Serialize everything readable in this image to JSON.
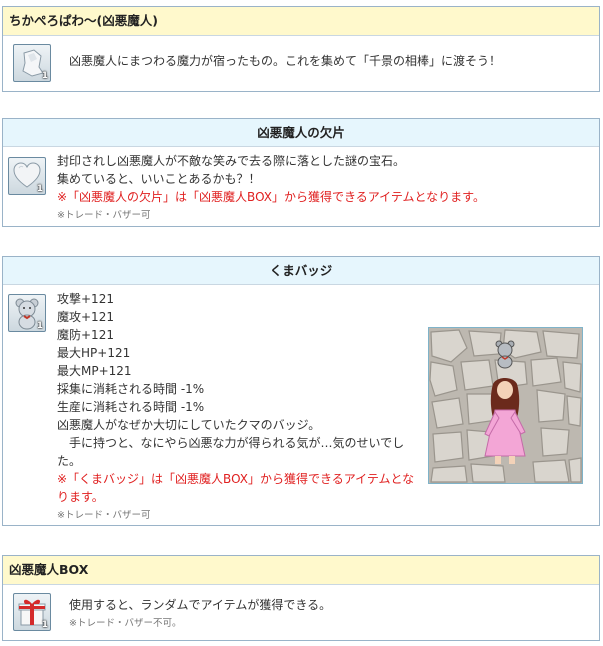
{
  "sections": [
    {
      "title": "ちかぺろぱわ～(凶悪魔人)",
      "icon": "white-fragment-icon",
      "quantity": "1",
      "lines": [
        "凶悪魔人にまつわる魔力が宿ったもの。これを集めて「千景の相棒」に渡そう！"
      ]
    },
    {
      "title": "凶悪魔人の欠片",
      "icon": "heart-stone-icon",
      "quantity": "1",
      "lines": [
        "封印されし凶悪魔人が不敵な笑みで去る際に落とした謎の宝石。",
        "集めていると、いいことあるかも？！"
      ],
      "red_note": "※「凶悪魔人の欠片」は「凶悪魔人BOX」から獲得できるアイテムとなります。",
      "trade_note": "※トレード・バザー可"
    },
    {
      "title": "くまバッジ",
      "icon": "bear-badge-icon",
      "quantity": "1",
      "lines": [
        "攻撃+121",
        "魔攻+121",
        "魔防+121",
        "最大HP+121",
        "最大MP+121",
        "採集に消耗される時間 -1%",
        "生産に消耗される時間 -1%",
        "凶悪魔人がなぜか大切にしていたクマのバッジ。",
        "　手に持つと、なにやら凶悪な力が得られる気が…気のせいでし",
        "た。"
      ],
      "red_lines": [
        "※「くまバッジ」は「凶悪魔人BOX」から獲得できるアイテムとな",
        "ります。"
      ],
      "trade_note": "※トレード・バザー可"
    },
    {
      "title": "凶悪魔人BOX",
      "icon": "gift-box-icon",
      "quantity": "1",
      "lines": [
        "使用すると、ランダムでアイテムが獲得できる。"
      ],
      "trade_note": "※トレード・バザー不可。"
    }
  ],
  "colors": {
    "header_yellow": "#fff9cc",
    "header_blue": "#e6f6fd",
    "border": "#9ab3c8",
    "red_text": "#e02020"
  }
}
